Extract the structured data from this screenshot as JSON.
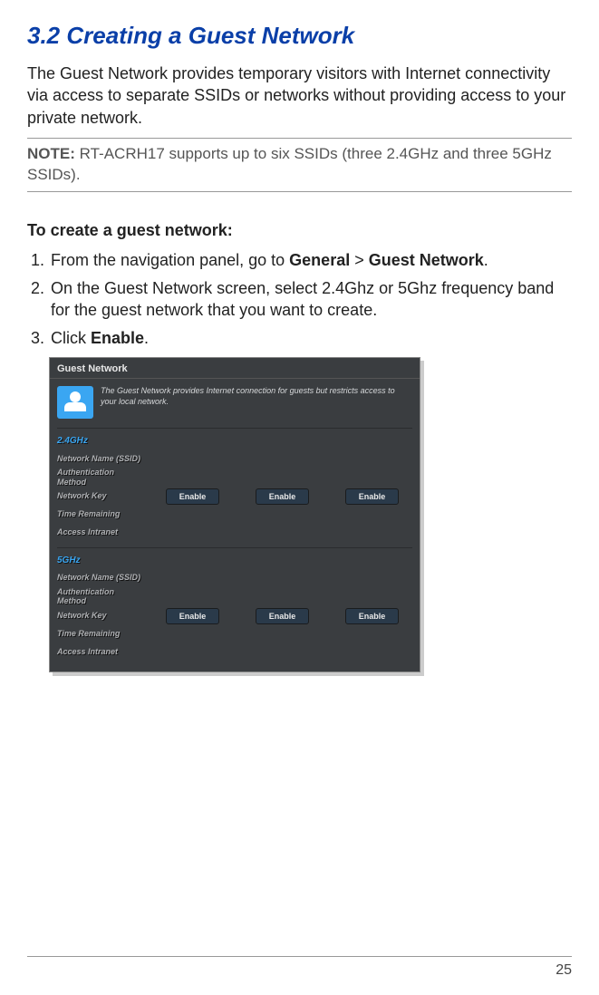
{
  "heading": "3.2    Creating a Guest Network",
  "intro": "The Guest Network provides temporary visitors with Internet connectivity via access to separate SSIDs or networks without providing access to your private network.",
  "note": {
    "label": "NOTE:",
    "text": "RT-ACRH17 supports up to six SSIDs (three 2.4GHz and three 5GHz SSIDs)."
  },
  "subhead": "To create a guest network:",
  "steps": {
    "s1_pre": "From the navigation panel, go to ",
    "s1_b1": "General",
    "s1_mid": " > ",
    "s1_b2": "Guest Network",
    "s1_post": ".",
    "s2": "On the Guest Network screen, select 2.4Ghz or 5Ghz frequency band for the guest network that you want to create.",
    "s3_pre": "Click ",
    "s3_b": "Enable",
    "s3_post": "."
  },
  "screenshot": {
    "title": "Guest Network",
    "desc": "The Guest Network provides Internet connection for guests but restricts access to your local network.",
    "bands": [
      {
        "label": "2.4GHz"
      },
      {
        "label": "5GHz"
      }
    ],
    "row_labels": {
      "ssid": "Network Name (SSID)",
      "auth": "Authentication Method",
      "key": "Network Key",
      "time": "Time Remaining",
      "intranet": "Access Intranet"
    },
    "enable": "Enable"
  },
  "page_number": "25"
}
